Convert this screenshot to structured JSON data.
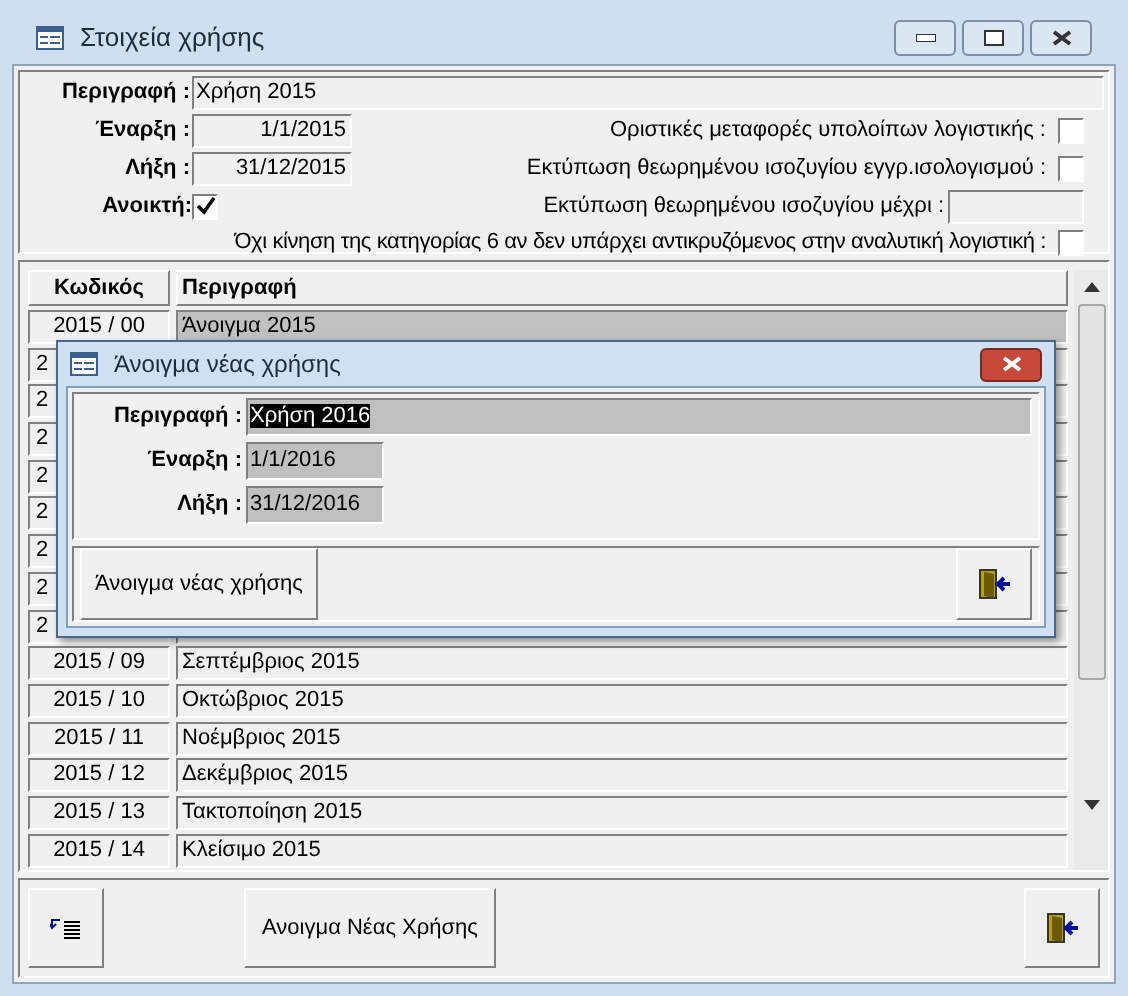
{
  "window": {
    "title": "Στοιχεία χρήσης"
  },
  "form": {
    "description_label": "Περιγραφή :",
    "description": "Χρήση 2015",
    "start_label": "Έναρξη :",
    "start": "1/1/2015",
    "end_label": "Λήξη :",
    "end": "31/12/2015",
    "open_label": "Ανοικτή:",
    "open": true,
    "options": [
      {
        "label": "Οριστικές μεταφορές υπολοίπων λογιστικής :",
        "kind": "checkbox",
        "checked": false
      },
      {
        "label": "Εκτύπωση θεωρημένου ισοζυγίου εγγρ.ισολογισμού :",
        "kind": "checkbox",
        "checked": false
      },
      {
        "label": "Εκτύπωση θεωρημένου ισοζυγίου μέχρι :",
        "kind": "field"
      },
      {
        "label": "Όχι κίνηση της κατηγορίας 6 αν δεν υπάρχει αντικρυζόμενος στην αναλυτική λογιστική :",
        "kind": "checkbox",
        "checked": false
      }
    ]
  },
  "table": {
    "columns": [
      "Κωδικός",
      "Περιγραφή"
    ],
    "rows": [
      {
        "code": "2015 / 00",
        "description": "Άνοιγμα 2015",
        "kind": "full",
        "selected": true
      },
      {
        "code": "2",
        "kind": "covered",
        "selected": false
      },
      {
        "code": "2",
        "kind": "covered",
        "selected": false
      },
      {
        "code": "2",
        "kind": "covered",
        "selected": false
      },
      {
        "code": "2",
        "kind": "covered",
        "selected": false
      },
      {
        "code": "2",
        "kind": "covered",
        "selected": false
      },
      {
        "code": "2",
        "kind": "covered",
        "selected": false
      },
      {
        "code": "2",
        "kind": "covered",
        "selected": false
      },
      {
        "code": "2",
        "kind": "covered",
        "selected": false
      },
      {
        "code": "2015 / 09",
        "description": "Σεπτέμβριος 2015",
        "kind": "full",
        "selected": false
      },
      {
        "code": "2015 / 10",
        "description": "Οκτώβριος 2015",
        "kind": "full",
        "selected": false
      },
      {
        "code": "2015 / 11",
        "description": "Νοέμβριος 2015",
        "kind": "full",
        "selected": false
      },
      {
        "code": "2015 / 12",
        "description": "Δεκέμβριος 2015",
        "kind": "full",
        "selected": false
      },
      {
        "code": "2015 / 13",
        "description": "Τακτοποίηση 2015",
        "kind": "full",
        "selected": false
      },
      {
        "code": "2015 / 14",
        "description": "Κλείσιμο 2015",
        "kind": "full",
        "selected": false
      }
    ]
  },
  "buttons": {
    "new_year": "Ανοιγμα Νέας Χρήσης"
  },
  "dialog": {
    "title": "Άνοιγμα νέας χρήσης",
    "description_label": "Περιγραφή :",
    "description": "Χρήση 2016",
    "start_label": "Έναρξη :",
    "start": "1/1/2016",
    "end_label": "Λήξη :",
    "end": "31/12/2016",
    "ok_button": "Άνοιγμα νέας χρήσης"
  }
}
